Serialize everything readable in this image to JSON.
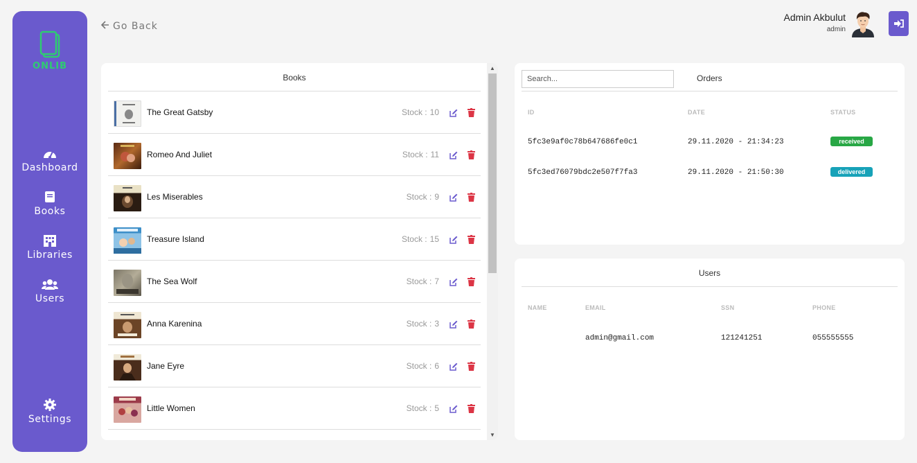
{
  "sidebar": {
    "logo_text": "ONLIB",
    "items": [
      {
        "label": "Dashboard",
        "icon": "gauge-icon"
      },
      {
        "label": "Books",
        "icon": "book-icon"
      },
      {
        "label": "Libraries",
        "icon": "building-icon"
      },
      {
        "label": "Users",
        "icon": "users-icon"
      },
      {
        "label": "Settings",
        "icon": "gear-icon"
      }
    ]
  },
  "header": {
    "go_back": "Go Back",
    "user_name": "Admin Akbulut",
    "user_role": "admin"
  },
  "books": {
    "title": "Books",
    "stock_label": "Stock :",
    "items": [
      {
        "title": "The Great Gatsby",
        "stock": "10"
      },
      {
        "title": "Romeo And Juliet",
        "stock": "11"
      },
      {
        "title": "Les Miserables",
        "stock": "9"
      },
      {
        "title": "Treasure Island",
        "stock": "15"
      },
      {
        "title": "The Sea Wolf",
        "stock": "7"
      },
      {
        "title": "Anna Karenina",
        "stock": "3"
      },
      {
        "title": "Jane Eyre",
        "stock": "6"
      },
      {
        "title": "Little Women",
        "stock": "5"
      }
    ]
  },
  "orders": {
    "search_placeholder": "Search...",
    "title": "Orders",
    "columns": [
      "ID",
      "DATE",
      "STATUS"
    ],
    "rows": [
      {
        "id": "5fc3e9af0c78b647686fe0c1",
        "date": "29.11.2020 - 21:34:23",
        "status": "received"
      },
      {
        "id": "5fc3ed76079bdc2e507f7fa3",
        "date": "29.11.2020 - 21:50:30",
        "status": "delivered"
      }
    ]
  },
  "users": {
    "title": "Users",
    "columns": [
      "NAME",
      "EMAIL",
      "SSN",
      "PHONE"
    ],
    "rows": [
      {
        "name": "",
        "email": "admin@gmail.com",
        "ssn": "121241251",
        "phone": "055555555"
      }
    ]
  },
  "colors": {
    "sidebar": "#6a5acd",
    "logo": "#2ecc71",
    "received": "#28a745",
    "delivered": "#17a2b8",
    "edit": "#6a5acd",
    "delete": "#dc3545"
  }
}
